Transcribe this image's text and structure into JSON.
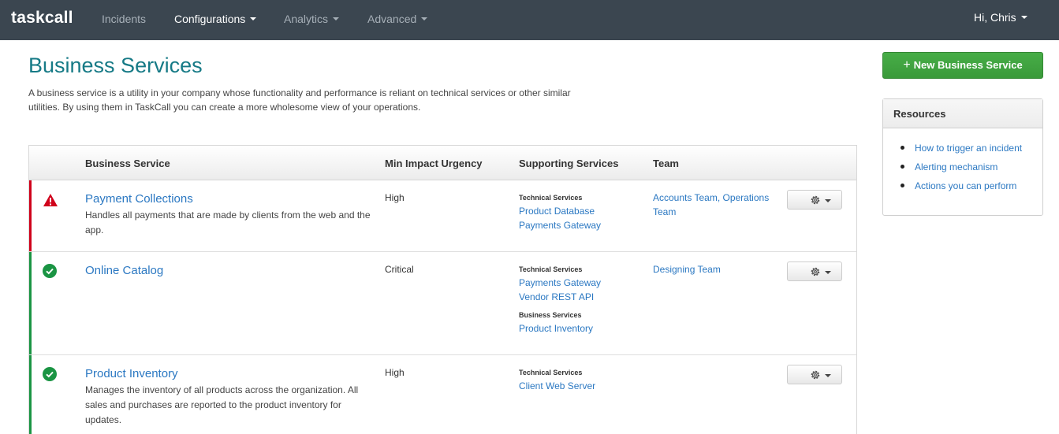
{
  "nav": {
    "brand": "taskcall",
    "items": [
      {
        "label": "Incidents"
      },
      {
        "label": "Configurations"
      },
      {
        "label": "Analytics"
      },
      {
        "label": "Advanced"
      }
    ],
    "user": "Hi, Chris"
  },
  "page": {
    "title": "Business Services",
    "description": "A business service is a utility in your company whose functionality and performance is reliant on technical services or other similar utilities. By using them in TaskCall you can create a more wholesome view of your operations."
  },
  "new_button": {
    "label": "New Business Service"
  },
  "resources": {
    "title": "Resources",
    "links": [
      "How to trigger an incident",
      "Alerting mechanism",
      "Actions you can perform"
    ]
  },
  "table": {
    "headers": [
      "Business Service",
      "Min Impact Urgency",
      "Supporting Services",
      "Team"
    ],
    "rows": [
      {
        "status": "warning",
        "status_color": "#d0021b",
        "name": "Payment Collections",
        "description": "Handles all payments that are made by clients from the web and the app.",
        "urgency": "High",
        "technical_label": "Technical Services",
        "technical": [
          "Product Database",
          "Payments Gateway"
        ],
        "business_label": "",
        "business": [],
        "team": "Accounts Team, Operations Team"
      },
      {
        "status": "ok",
        "status_color": "#1a9443",
        "name": "Online Catalog",
        "description": "",
        "urgency": "Critical",
        "technical_label": "Technical Services",
        "technical": [
          "Payments Gateway",
          "Vendor REST API"
        ],
        "business_label": "Business Services",
        "business": [
          "Product Inventory"
        ],
        "team": "Designing Team"
      },
      {
        "status": "ok",
        "status_color": "#1a9443",
        "name": "Product Inventory",
        "description": "Manages the inventory of all products across the organization. All sales and purchases are reported to the product inventory for updates.",
        "urgency": "High",
        "technical_label": "Technical Services",
        "technical": [
          "Client Web Server"
        ],
        "business_label": "",
        "business": [],
        "team": ""
      }
    ]
  }
}
